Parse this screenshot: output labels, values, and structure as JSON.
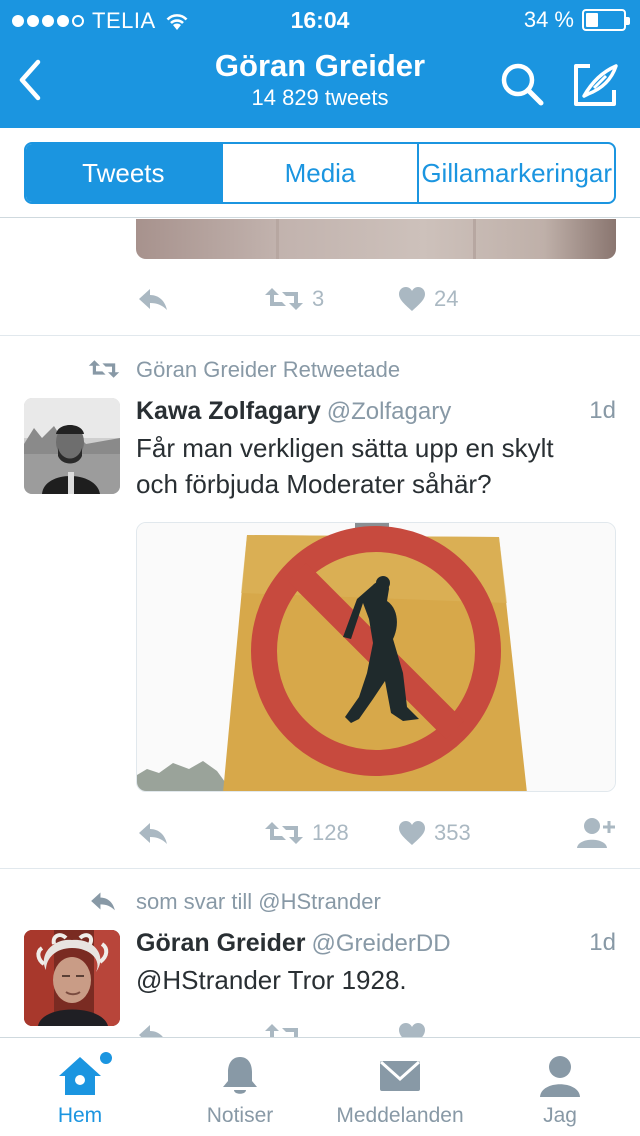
{
  "status_bar": {
    "carrier": "TELIA",
    "time": "16:04",
    "battery": "34 %",
    "battery_level": 0.34
  },
  "header": {
    "name": "Göran Greider",
    "tweet_count": "14 829 tweets",
    "icons": {
      "back": "chevron-left-icon",
      "search": "search-icon",
      "compose": "compose-icon"
    }
  },
  "tabs_control": {
    "items": [
      "Tweets",
      "Media",
      "Gillamarkeringar"
    ],
    "active": "Tweets"
  },
  "timeline": {
    "prev_tweet": {
      "retweets": "3",
      "likes": "24"
    },
    "tweet1": {
      "context": "Göran Greider Retweetade",
      "name": "Kawa Zolfagary",
      "handle": "@Zolfagary",
      "time": "1d",
      "text_line1": "Får man verkligen sätta upp en skylt",
      "text_line2": "och förbjuda Moderater såhär?",
      "retweets": "128",
      "likes": "353"
    },
    "tweet2": {
      "context": "som svar till @HStrander",
      "name": "Göran Greider",
      "handle": "@GreiderDD",
      "time": "1d",
      "text": "@HStrander Tror 1928."
    }
  },
  "tabbar": {
    "items": [
      "Hem",
      "Notiser",
      "Meddelanden",
      "Jag"
    ],
    "icons": [
      "home-icon",
      "bell-icon",
      "envelope-icon",
      "person-icon"
    ],
    "active": "Hem"
  },
  "colors": {
    "brand": "#1b95e0",
    "muted": "#8899a6",
    "text": "#292f33"
  }
}
